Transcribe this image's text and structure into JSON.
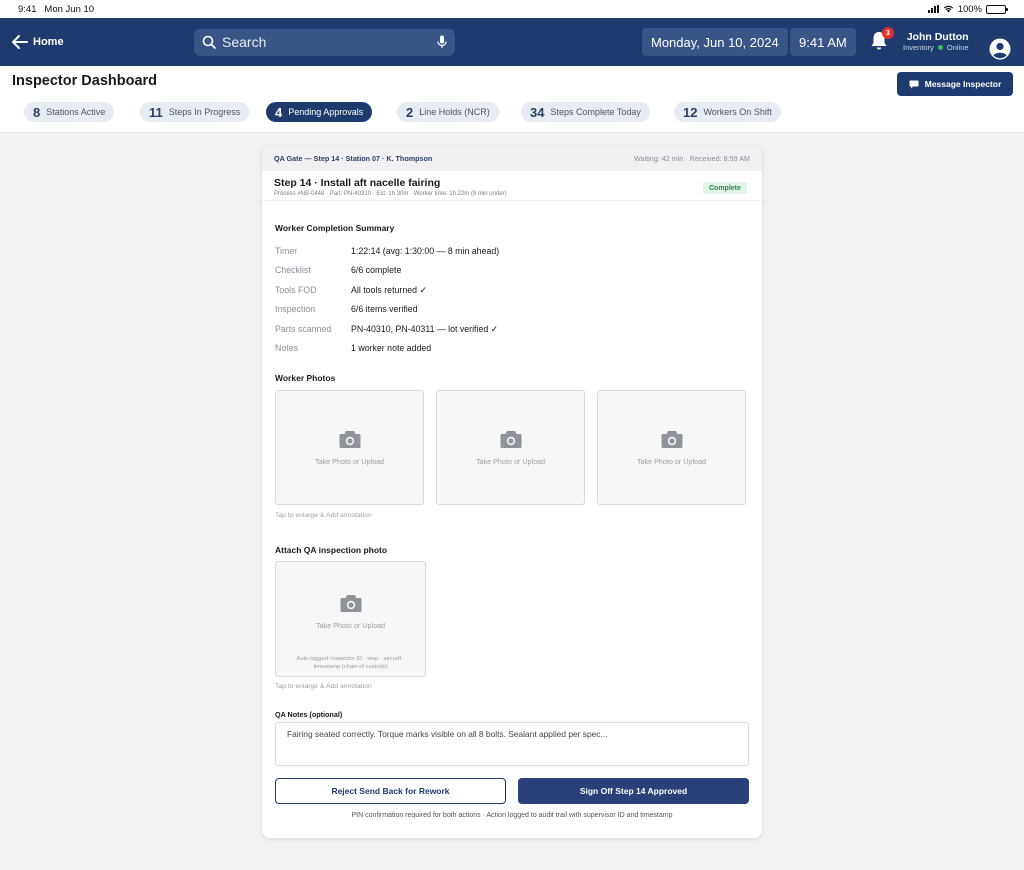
{
  "status_bar": {
    "time": "9:41",
    "date": "Mon Jun 10",
    "battery": "100%"
  },
  "nav": {
    "home_label": "Home",
    "search_placeholder": "Search",
    "date": "Monday, Jun 10, 2024",
    "time": "9:41 AM",
    "notification_count": "3",
    "user_name": "John Dutton",
    "user_role": "Inventory",
    "user_status": "Online"
  },
  "header": {
    "title": "Inspector Dashboard",
    "message_button": "Message Inspector",
    "stats": [
      {
        "num": "8",
        "label": "Stations Active"
      },
      {
        "num": "11",
        "label": "Steps In Progress"
      },
      {
        "num": "4",
        "label": "Pending Approvals"
      },
      {
        "num": "2",
        "label": "Line Holds (NCR)"
      },
      {
        "num": "34",
        "label": "Steps Complete Today"
      },
      {
        "num": "12",
        "label": "Workers On Shift"
      }
    ]
  },
  "card": {
    "context": "QA Gate — Step 14 · Station 07 · K. Thompson",
    "waiting": "Waiting: 42 min · Received: 8:59 AM",
    "step_title": "Step 14 · Install aft nacelle fairing",
    "step_meta": "Process #NB-0448 · Part: PN-40310 · Est: 1h 30m · Worker time: 1h 22m (8 min under)",
    "status_badge": "Complete",
    "summary_title": "Worker Completion Summary",
    "summary": [
      {
        "k": "Timer",
        "v": "1:22:14  (avg: 1:30:00 — 8 min ahead)"
      },
      {
        "k": "Checklist",
        "v": "6/6 complete"
      },
      {
        "k": "Tools FOD",
        "v": "All tools returned ✓"
      },
      {
        "k": "Inspection",
        "v": "6/6 items verified"
      },
      {
        "k": "Parts scanned",
        "v": "PN-40310, PN-40311 — lot verified ✓"
      },
      {
        "k": "Notes",
        "v": "1 worker note added"
      }
    ],
    "photos_title": "Worker Photos",
    "photo_label": "Take Photo or Upload",
    "photos_hint": "Tap to enlarge & Add annotation",
    "qa_photo_title": "Attach QA inspection photo",
    "qa_photo_label": "Take Photo or Upload",
    "qa_photo_small": "Auto-tagged: inspector ID · step · aircraft · timestamp (chain of custody)",
    "qa_photo_hint": "Tap to enlarge & Add annotation",
    "notes_label": "QA Notes (optional)",
    "notes_value": "Fairing seated correctly. Torque marks visible on all 8 bolts. Sealant applied per spec...",
    "reject_button": "Reject  Send Back for Rework",
    "sign_button": "Sign Off  Step 14 Approved",
    "footnote": "PIN confirmation required for both actions · Action logged to audit trail with supervisor ID and timestamp"
  }
}
